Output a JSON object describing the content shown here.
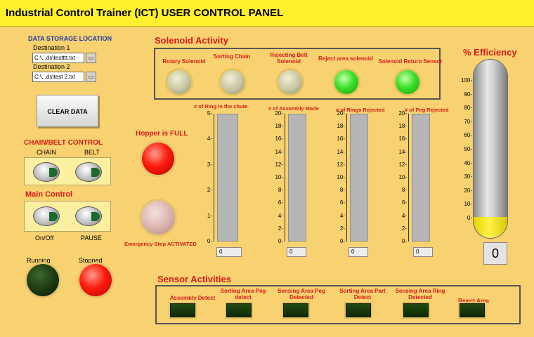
{
  "title": "Industrial Control  Trainer (ICT) USER CONTROL PANEL",
  "data_storage": {
    "heading": "DATA STORAGE LOCATION",
    "dest1_label": "Destination 1",
    "dest1_value": "C:\\...ds\\testttt.txt",
    "dest2_label": "Destination 2",
    "dest2_value": "C:\\...ds\\test 2.txt"
  },
  "clear_button": "CLEAR DATA",
  "chain_belt": {
    "heading": "CHAIN/BELT CONTROL",
    "chain": "CHAIN",
    "belt": "BELT"
  },
  "main_control": {
    "heading": "Main Control",
    "onoff": "On/Off",
    "pause": "PAUSE"
  },
  "status": {
    "running": "Running",
    "stopped": "Stopped"
  },
  "hopper_label": "Hopper is FULL",
  "emergency_label": "Emergency Stop ACTIVATED",
  "solenoid": {
    "heading": "Solenoid Activity",
    "items": [
      {
        "label": "Rotary Solenoid",
        "state": "off"
      },
      {
        "label": "Sorting Chain",
        "state": "off"
      },
      {
        "label": "Rejecting Belt Solenoid",
        "state": "off"
      },
      {
        "label": "Reject area solenoid",
        "state": "on"
      },
      {
        "label": "Solenoid Return Sensor",
        "state": "on"
      }
    ]
  },
  "tanks": [
    {
      "title": "# of Ring in the chute",
      "ticks": [
        "5-",
        "4-",
        "3-",
        "2-",
        "1-",
        "0-"
      ],
      "value": "0"
    },
    {
      "title": "# of Assembly Made",
      "ticks": [
        "20-",
        "18-",
        "16-",
        "14-",
        "12-",
        "10-",
        "8-",
        "6-",
        "4-",
        "2-",
        "0-"
      ],
      "value": "0"
    },
    {
      "title": "# of Rings Rejected",
      "ticks": [
        "20-",
        "18-",
        "16-",
        "14-",
        "12-",
        "10-",
        "8-",
        "6-",
        "4-",
        "2-",
        "0-"
      ],
      "value": "0"
    },
    {
      "title": "# of Peg Rejected",
      "ticks": [
        "20-",
        "18-",
        "16-",
        "14-",
        "12-",
        "10-",
        "8-",
        "6-",
        "4-",
        "2-",
        "0-"
      ],
      "value": "0"
    }
  ],
  "efficiency": {
    "heading": "% Efficiency",
    "ticks": [
      "100-",
      "90-",
      "80-",
      "70-",
      "60-",
      "50-",
      "40-",
      "30-",
      "20-",
      "10-",
      "0-"
    ],
    "value": "0"
  },
  "sensor": {
    "heading": "Sensor Activities",
    "items": [
      {
        "label": "Assembly Detect"
      },
      {
        "label": "Sorting Area Peg detect"
      },
      {
        "label": "Sensing Area Peg Detected"
      },
      {
        "label": "Sorting Area Part Detect"
      },
      {
        "label": "Sensing Area Ring Detected"
      },
      {
        "label": "Reject Area"
      }
    ]
  },
  "colors": {
    "background": "#f8d271",
    "titlebar": "#fff02e",
    "alarm_red": "#ff1c0f",
    "indicator_green": "#3be12a",
    "heading_red": "#d61b1b"
  }
}
